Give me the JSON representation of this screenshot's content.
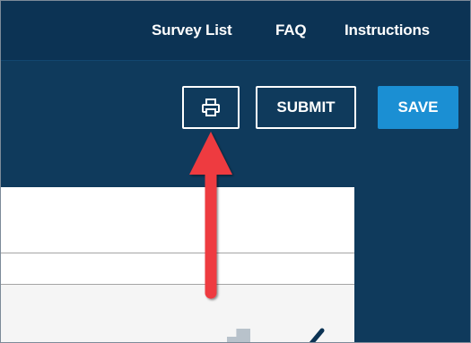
{
  "nav": {
    "survey_list": "Survey List",
    "faq": "FAQ",
    "instructions": "Instructions"
  },
  "toolbar": {
    "print_icon": "printer-icon",
    "submit_label": "SUBMIT",
    "save_label": "SAVE"
  },
  "colors": {
    "topbar": "#0c3354",
    "background": "#0f3a5c",
    "save_button": "#1b8fd3",
    "arrow": "#ee3a3f"
  },
  "icons": {
    "panel_gray_icon": "folder-icon",
    "panel_pencil": "pencil-icon"
  }
}
